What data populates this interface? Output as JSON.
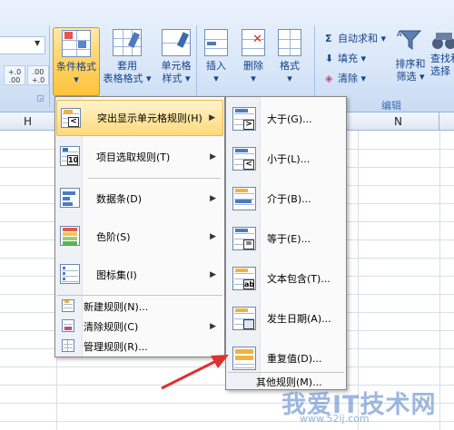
{
  "ribbon": {
    "cond_format": {
      "label1": "条件格式",
      "label2": "▾"
    },
    "table_format": {
      "label1": "套用",
      "label2": "表格格式 ▾"
    },
    "cell_style": {
      "label1": "单元格",
      "label2": "样式 ▾"
    },
    "insert": {
      "label1": "插入",
      "label2": "▾"
    },
    "delete": {
      "label1": "删除",
      "label2": "▾"
    },
    "format": {
      "label1": "格式",
      "label2": "▾"
    },
    "autosum": "自动求和 ▾",
    "fill": "填充 ▾",
    "clear": "清除 ▾",
    "sort_filter": {
      "label1": "排序和",
      "label2": "筛选 ▾"
    },
    "find_select": {
      "label1": "查找和",
      "label2": "选择 ▾"
    },
    "edit_group_label": "编辑",
    "inc_decimal": {
      "top": "+.0",
      "bottom": ".00"
    },
    "dec_decimal": {
      "top": ".00",
      "bottom": "+.0"
    }
  },
  "sheet": {
    "columns": [
      "H",
      "N"
    ]
  },
  "main_menu": {
    "items": [
      {
        "label": "突出显示单元格规则(H)",
        "has_arrow": true
      },
      {
        "label": "项目选取规则(T)",
        "has_arrow": true
      },
      {
        "label": "数据条(D)",
        "has_arrow": true
      },
      {
        "label": "色阶(S)",
        "has_arrow": true
      },
      {
        "label": "图标集(I)",
        "has_arrow": true
      },
      {
        "label": "新建规则(N)...",
        "has_arrow": false
      },
      {
        "label": "清除规则(C)",
        "has_arrow": true
      },
      {
        "label": "管理规则(R)...",
        "has_arrow": false
      }
    ],
    "arrow_glyph": "▶"
  },
  "sub_menu": {
    "items": [
      {
        "label": "大于(G)...",
        "symbol": ">"
      },
      {
        "label": "小于(L)...",
        "symbol": "<"
      },
      {
        "label": "介于(B)...",
        "symbol": ""
      },
      {
        "label": "等于(E)...",
        "symbol": "="
      },
      {
        "label": "文本包含(T)...",
        "symbol": "ab"
      },
      {
        "label": "发生日期(A)...",
        "symbol": ""
      },
      {
        "label": "重复值(D)...",
        "symbol": ""
      }
    ],
    "other": "其他规则(M)..."
  },
  "colors": {
    "accent_red": "#e03030",
    "hover_bg": "#ffd97a"
  },
  "watermark": {
    "text": "我爱IT技术网",
    "url": "www.52ij.com"
  }
}
